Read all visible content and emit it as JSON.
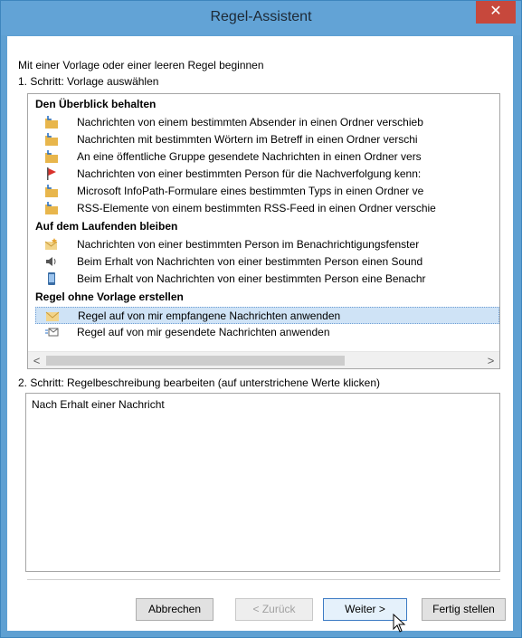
{
  "window": {
    "title": "Regel-Assistent",
    "close_label": "✕"
  },
  "intro": {
    "line1": "Mit einer Vorlage oder einer leeren Regel beginnen",
    "line2": "1. Schritt: Vorlage auswählen"
  },
  "groups": [
    {
      "label": "Den Überblick behalten"
    },
    {
      "label": "Auf dem Laufenden bleiben"
    },
    {
      "label": "Regel ohne Vorlage erstellen"
    }
  ],
  "rules": [
    {
      "label": "Nachrichten von einem bestimmten Absender in einen Ordner verschieb",
      "icon": "folder-arrow-icon"
    },
    {
      "label": "Nachrichten mit bestimmten Wörtern im Betreff in einen Ordner verschi",
      "icon": "folder-arrow-icon"
    },
    {
      "label": "An eine öffentliche Gruppe gesendete Nachrichten in einen Ordner vers",
      "icon": "folder-arrow-icon"
    },
    {
      "label": "Nachrichten von einer bestimmten Person für die Nachverfolgung kenn:",
      "icon": "flag-icon"
    },
    {
      "label": "Microsoft InfoPath-Formulare eines bestimmten Typs in einen Ordner ve",
      "icon": "folder-arrow-icon"
    },
    {
      "label": "RSS-Elemente von einem bestimmten RSS-Feed in einen Ordner verschie",
      "icon": "folder-arrow-icon"
    },
    {
      "label": "Nachrichten von einer bestimmten Person im Benachrichtigungsfenster",
      "icon": "envelope-star-icon"
    },
    {
      "label": "Beim Erhalt von Nachrichten von einer bestimmten Person einen Sound",
      "icon": "speaker-icon"
    },
    {
      "label": "Beim Erhalt von Nachrichten von einer bestimmten Person eine Benachr",
      "icon": "phone-icon"
    },
    {
      "label": "Regel auf von mir empfangene Nachrichten anwenden",
      "icon": "envelope-icon",
      "selected": true
    },
    {
      "label": "Regel auf von mir gesendete Nachrichten anwenden",
      "icon": "sent-mail-icon"
    }
  ],
  "step2": {
    "label": "2. Schritt: Regelbeschreibung bearbeiten (auf unterstrichene Werte klicken)",
    "description": "Nach Erhalt einer Nachricht"
  },
  "scroll": {
    "left": "<",
    "right": ">"
  },
  "buttons": {
    "cancel": "Abbrechen",
    "back": "< Zurück",
    "next": "Weiter >",
    "finish": "Fertig stellen"
  },
  "colors": {
    "titlebar": "#62a3d6",
    "close": "#c7483c",
    "selection": "#cfe3f6"
  }
}
